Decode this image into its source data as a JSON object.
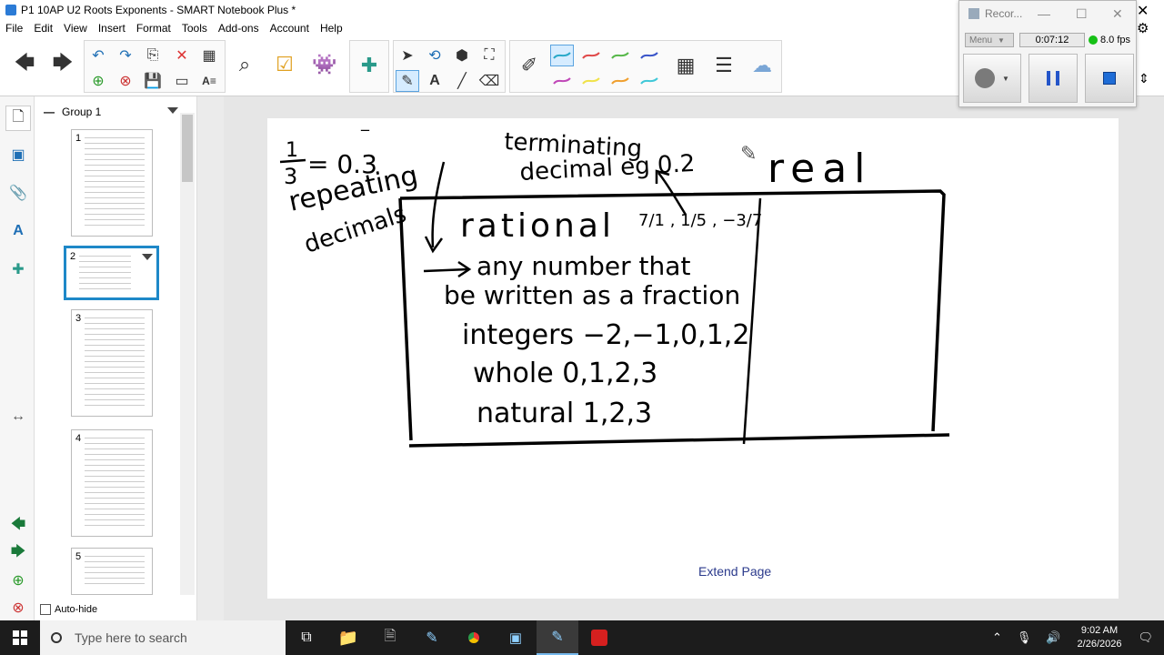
{
  "window": {
    "title": "P1 10AP U2 Roots Exponents - SMART Notebook Plus *"
  },
  "menu": [
    "File",
    "Edit",
    "View",
    "Insert",
    "Format",
    "Tools",
    "Add-ons",
    "Account",
    "Help"
  ],
  "sidebar": {
    "group_label": "Group 1",
    "pages": [
      "1",
      "2",
      "3",
      "4",
      "5"
    ],
    "autohide_label": "Auto-hide"
  },
  "page": {
    "extend_label": "Extend Page",
    "ink": {
      "fraction_num": "1",
      "fraction_den": "3",
      "equals_decimal": "= 0.3",
      "repeat_bar": "‾",
      "repeating": "repeating",
      "decimals": "decimals",
      "terminating": "terminating",
      "decimal_eg": "decimal eg 0.2",
      "real": "real",
      "rational": "rational",
      "rational_examples": "7/1 , 1/5 , −3/7",
      "any_number_that": "any number that",
      "be_written": "be written as a fraction",
      "integers": "integers −2,−1,0,1,2",
      "whole": "whole 0,1,2,3",
      "natural": "natural 1,2,3"
    }
  },
  "recorder": {
    "title": "Recor...",
    "menu_label": "Menu",
    "time": "0:07:12",
    "fps": "8.0 fps"
  },
  "taskbar": {
    "search_placeholder": "Type here to search",
    "time": "9:02 AM",
    "date": "2/26/2026"
  },
  "colors": {
    "selection": "#1e88c8",
    "pen_cyan": "#2aa9c9",
    "pen_red": "#e04a4a",
    "pen_green": "#58b84a",
    "pen_blue": "#3a55c9",
    "pen_magenta": "#c048b8",
    "pen_yellow": "#f0e24a",
    "pen_orange": "#f0a030",
    "pen_aqua": "#40c8d8"
  }
}
